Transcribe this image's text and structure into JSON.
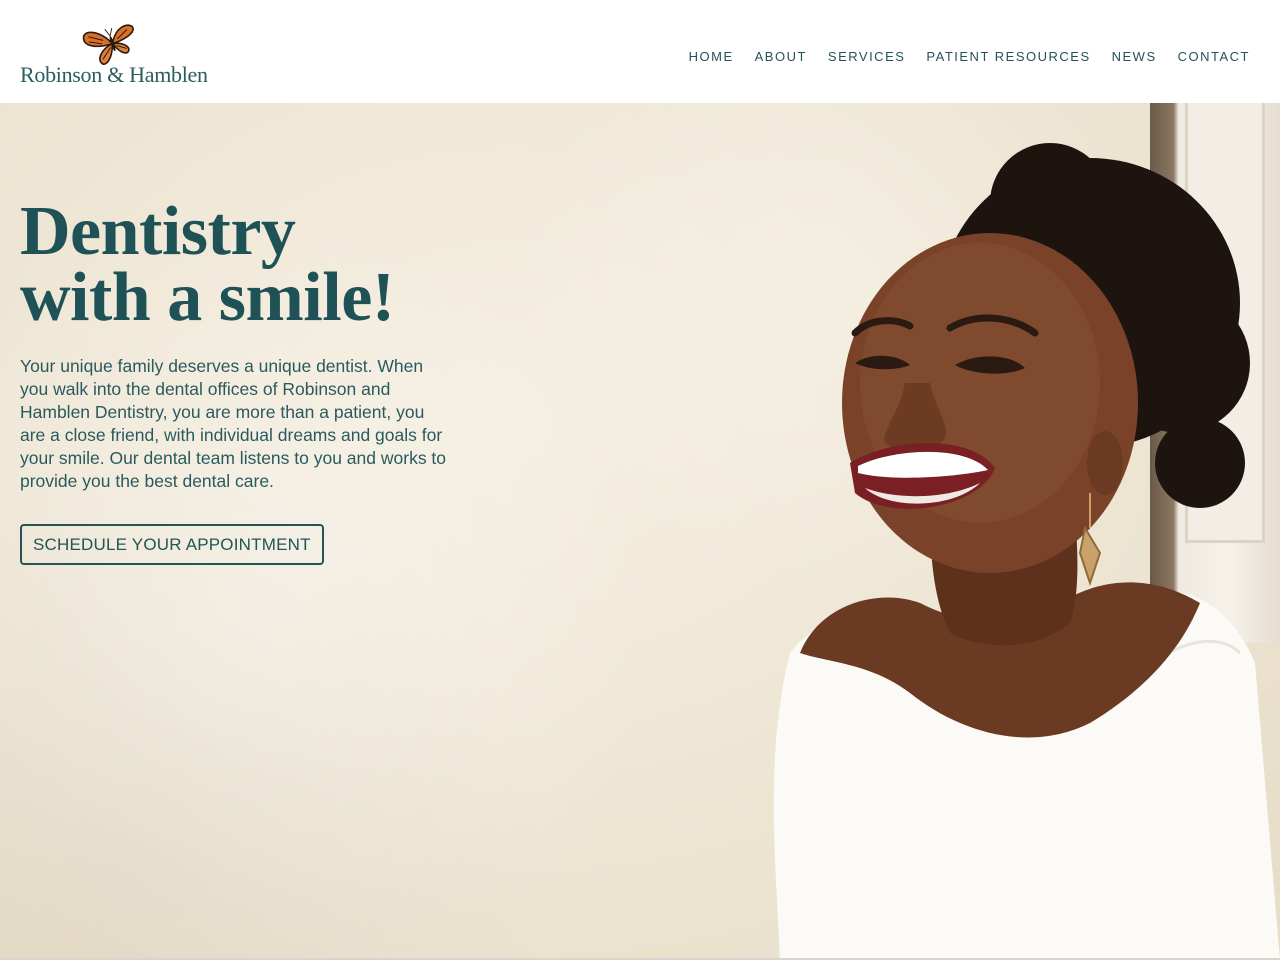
{
  "header": {
    "logo_text": "Robinson & Hamblen",
    "nav": [
      "HOME",
      "ABOUT",
      "SERVICES",
      "PATIENT RESOURCES",
      "NEWS",
      "CONTACT"
    ]
  },
  "hero": {
    "title_line1": "Dentistry",
    "title_line2": "with a smile!",
    "description": "Your unique family deserves a unique dentist. When you walk into the dental offices of Robinson and Hamblen Dentistry, you are more than a patient, you are a close friend, with individual dreams and goals for your smile. Our dental team listens to you and works to provide you the best dental care.",
    "cta_label": "SCHEDULE YOUR APPOINTMENT"
  },
  "colors": {
    "brand_teal": "#245358",
    "butterfly_orange": "#d9702a",
    "wall_cream": "#efe7d6"
  },
  "icons": {
    "logo_mark": "butterfly-icon"
  }
}
